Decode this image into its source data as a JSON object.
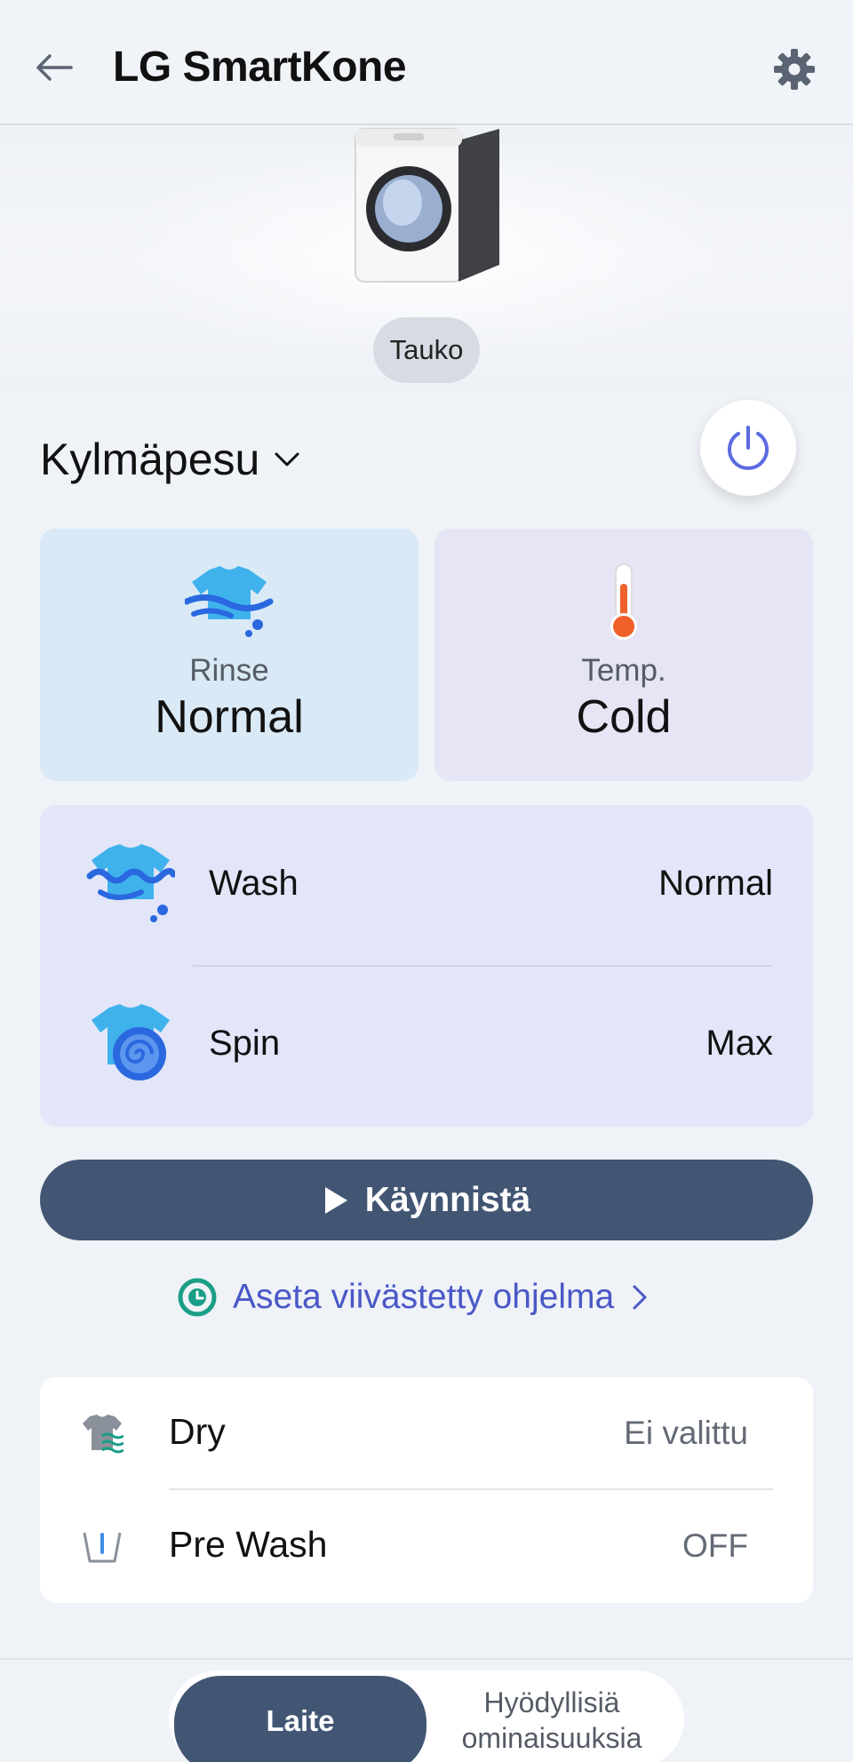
{
  "header": {
    "title": "LG SmartKone"
  },
  "hero": {
    "status": "Tauko"
  },
  "program": {
    "name": "Kylmäpesu"
  },
  "cards": {
    "rinse": {
      "label": "Rinse",
      "value": "Normal"
    },
    "temp": {
      "label": "Temp.",
      "value": "Cold"
    }
  },
  "settings": {
    "wash": {
      "label": "Wash",
      "value": "Normal"
    },
    "spin": {
      "label": "Spin",
      "value": "Max"
    }
  },
  "start_label": "Käynnistä",
  "delay_label": "Aseta viivästetty ohjelma",
  "options": {
    "dry": {
      "label": "Dry",
      "value": "Ei valittu"
    },
    "prewash": {
      "label": "Pre Wash",
      "value": "OFF"
    }
  },
  "tabs": {
    "device": "Laite",
    "features_line1": "Hyödyllisiä",
    "features_line2": "ominaisuuksia"
  },
  "colors": {
    "accent": "#425674",
    "link": "#4a58c7",
    "power": "#5b6be0",
    "rinse_card": "#d9e9f6",
    "temp_card": "#e6e5f6",
    "panel": "#e2e6f8"
  }
}
